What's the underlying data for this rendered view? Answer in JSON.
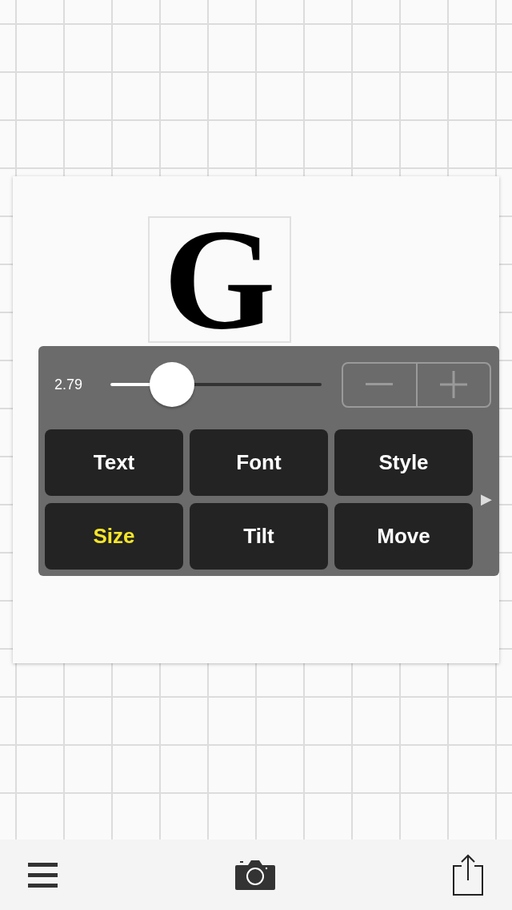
{
  "canvas": {
    "letter": "G"
  },
  "panel": {
    "slider": {
      "reading": "2.79",
      "level": 0.29
    },
    "buttons": [
      {
        "label": "Text",
        "selected": false
      },
      {
        "label": "Font",
        "selected": false
      },
      {
        "label": "Style",
        "selected": false
      },
      {
        "label": "Size",
        "selected": true
      },
      {
        "label": "Tilt",
        "selected": false
      },
      {
        "label": "Move",
        "selected": false
      }
    ],
    "more_arrow": "▶"
  }
}
